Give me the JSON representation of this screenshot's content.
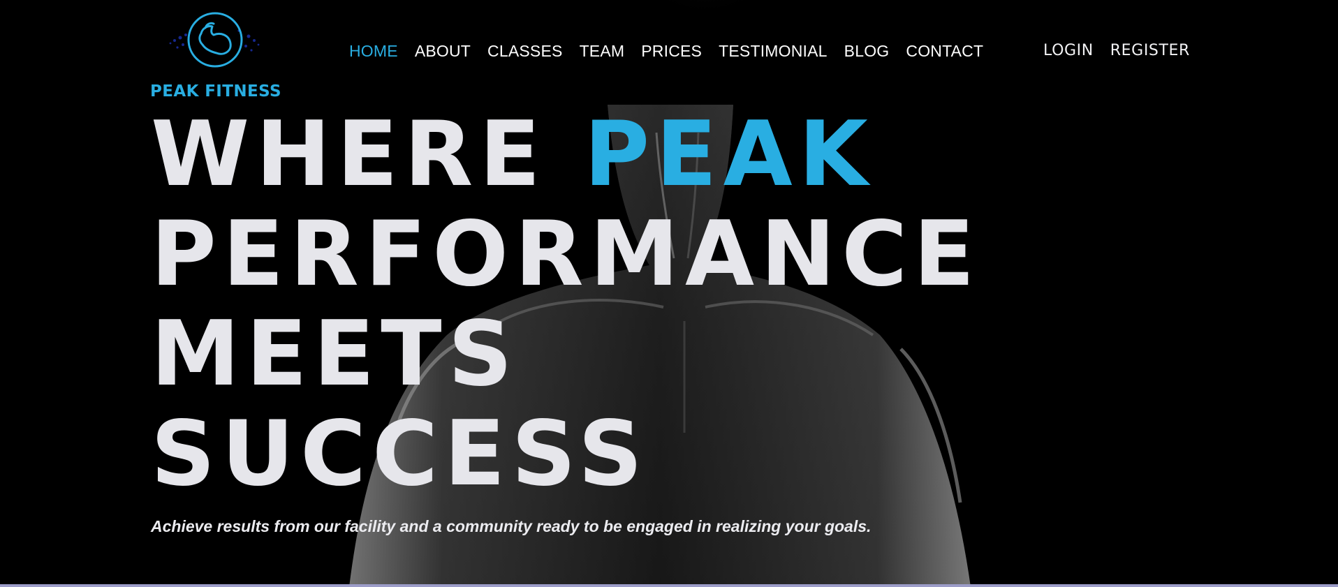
{
  "brand": {
    "name": "PEAK FITNESS",
    "logo_icon": "flexed-bicep-icon",
    "accent_color": "#29aee2"
  },
  "nav": {
    "items": [
      {
        "label": "HOME",
        "active": true
      },
      {
        "label": "ABOUT",
        "active": false
      },
      {
        "label": "CLASSES",
        "active": false
      },
      {
        "label": "TEAM",
        "active": false
      },
      {
        "label": "PRICES",
        "active": false
      },
      {
        "label": "TESTIMONIAL",
        "active": false
      },
      {
        "label": "BLOG",
        "active": false
      },
      {
        "label": "CONTACT",
        "active": false
      }
    ]
  },
  "auth": {
    "login_label": "LOGIN",
    "register_label": "REGISTER"
  },
  "hero": {
    "headline_word_1": "WHERE",
    "headline_accent": "PEAK",
    "headline_line_2": "PERFORMANCE",
    "headline_line_3": "MEETS",
    "headline_line_4": "SUCCESS",
    "tagline": "Achieve results from our facility and a community ready to be engaged in realizing your goals."
  }
}
